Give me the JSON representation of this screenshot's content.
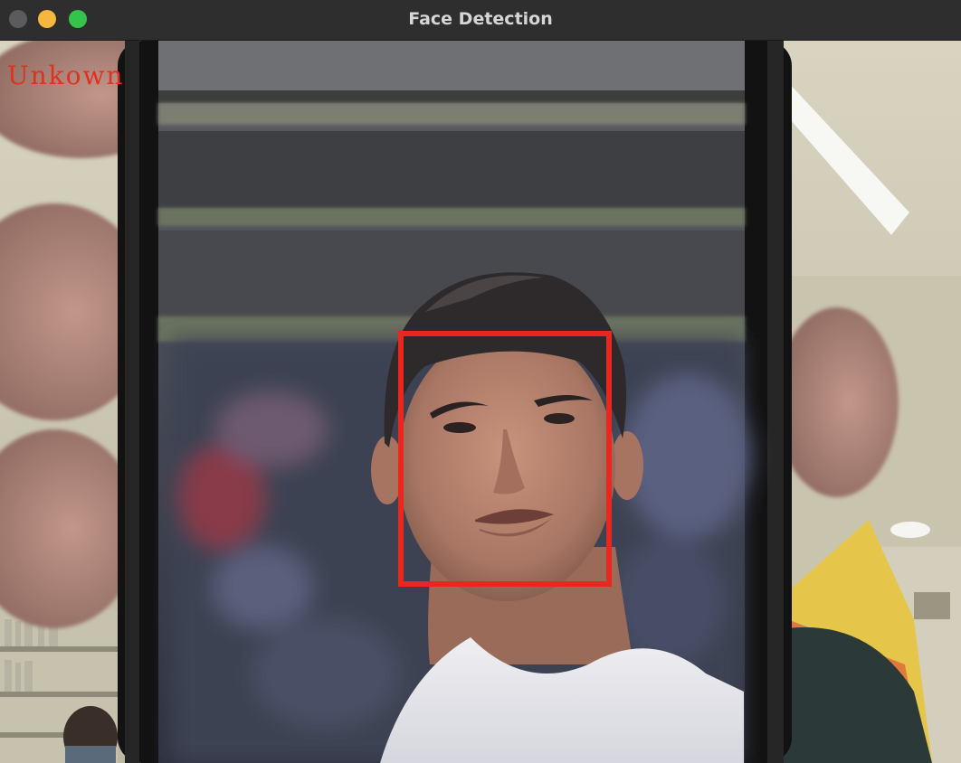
{
  "window": {
    "title": "Face Detection"
  },
  "detection": {
    "label": "Unkown",
    "box_color": "#e8281e"
  },
  "icons": {
    "close": "close-traffic-light",
    "minimize": "minimize-traffic-light",
    "maximize": "zoom-traffic-light"
  }
}
